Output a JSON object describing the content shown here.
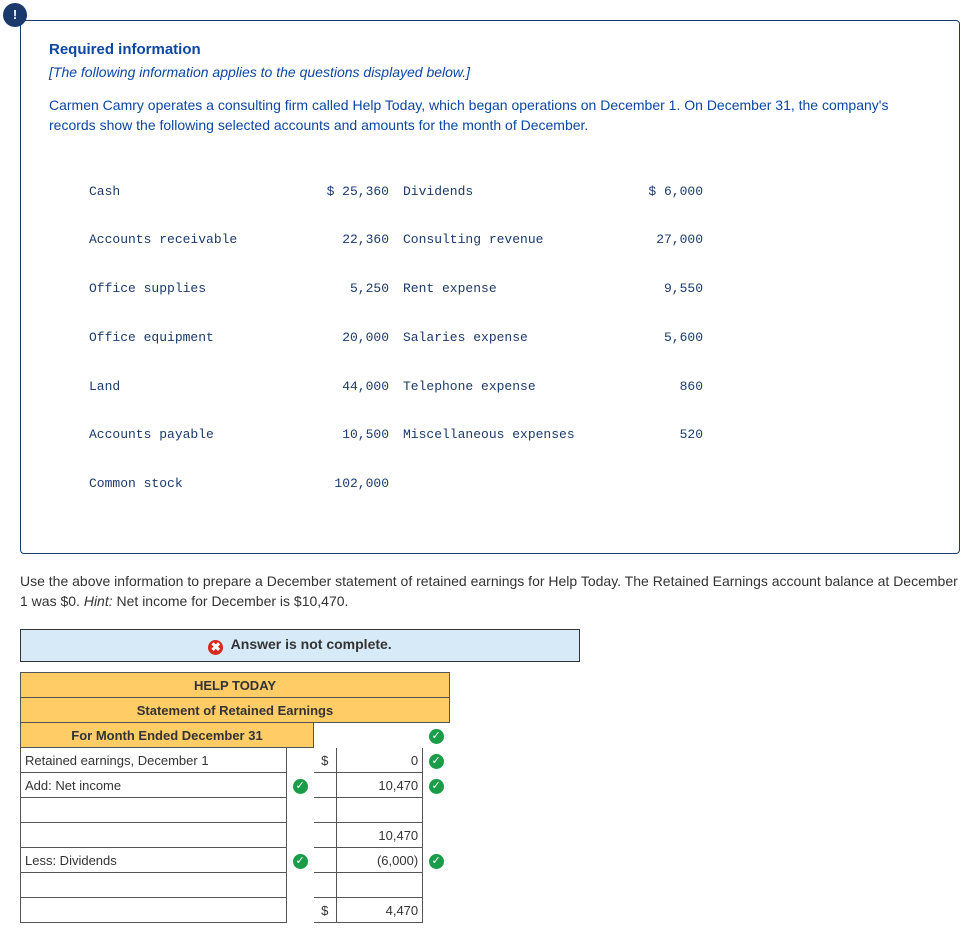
{
  "info": {
    "bang": "!",
    "title": "Required information",
    "bracket": "[The following information applies to the questions displayed below.]",
    "narr": "Carmen Camry operates a consulting firm called Help Today, which began operations on December 1. On December 31, the company's records show the following selected accounts and amounts for the month of December."
  },
  "accounts": [
    {
      "l": "Cash",
      "lv": "$ 25,360",
      "r": "Dividends",
      "rv": "$ 6,000"
    },
    {
      "l": "Accounts receivable",
      "lv": "22,360",
      "r": "Consulting revenue",
      "rv": "27,000"
    },
    {
      "l": "Office supplies",
      "lv": "5,250",
      "r": "Rent expense",
      "rv": "9,550"
    },
    {
      "l": "Office equipment",
      "lv": "20,000",
      "r": "Salaries expense",
      "rv": "5,600"
    },
    {
      "l": "Land",
      "lv": "44,000",
      "r": "Telephone expense",
      "rv": "860"
    },
    {
      "l": "Accounts payable",
      "lv": "10,500",
      "r": "Miscellaneous expenses",
      "rv": "520"
    },
    {
      "l": "Common stock",
      "lv": "102,000",
      "r": "",
      "rv": ""
    }
  ],
  "instr": {
    "a": "Use the above information to prepare a December statement of retained earnings for Help Today. The Retained Earnings account balance at December 1 was $0. ",
    "hint_label": "Hint:",
    "hint_text": " Net income for December is $10,470."
  },
  "answer_banner": "Answer is not complete.",
  "x_glyph": "✖",
  "chk_glyph": "✓",
  "stmt": {
    "h1": "HELP TODAY",
    "h2": "Statement of Retained Earnings",
    "h3": "For Month Ended December 31",
    "r1_label": "Retained earnings, December 1",
    "r1_dol": "$",
    "r1_val": "0",
    "r2_label": "Add: Net income",
    "r2_val": "10,470",
    "subtotal": "10,470",
    "r3_label": "Less: Dividends",
    "r3_val": "(6,000)",
    "final_dol": "$",
    "final_val": "4,470"
  }
}
